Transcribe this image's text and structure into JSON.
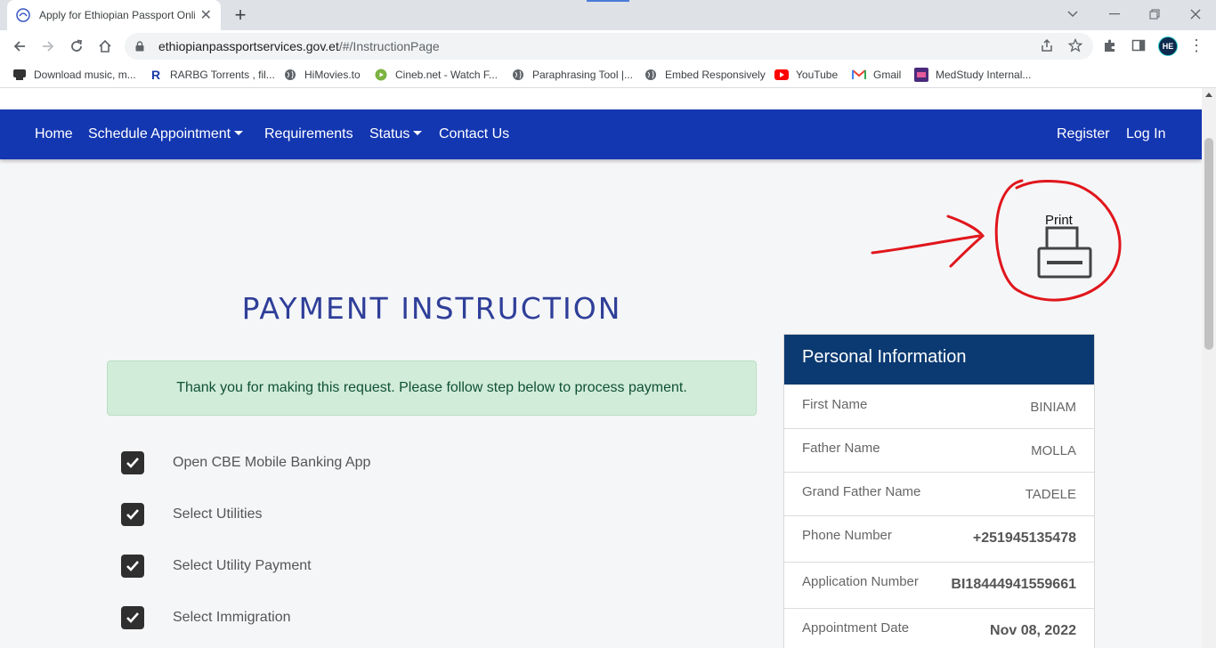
{
  "browser": {
    "tab_title": "Apply for Ethiopian Passport Onli",
    "url_host": "ethiopianpassportservices.gov.et",
    "url_path": "/#/InstructionPage",
    "new_tab": "+",
    "close_tab": "✕",
    "profile_initials": "HE",
    "bookmarks": [
      {
        "label": "Download music, m...",
        "icon": "download-icon"
      },
      {
        "label": "RARBG Torrents , fil...",
        "icon": "rarbg-icon"
      },
      {
        "label": "HiMovies.to",
        "icon": "globe-icon"
      },
      {
        "label": "Cineb.net - Watch F...",
        "icon": "cineb-icon"
      },
      {
        "label": "Paraphrasing Tool |...",
        "icon": "globe-icon"
      },
      {
        "label": "Embed Responsively",
        "icon": "globe-icon"
      },
      {
        "label": "YouTube",
        "icon": "youtube-icon"
      },
      {
        "label": "Gmail",
        "icon": "gmail-icon"
      },
      {
        "label": "MedStudy Internal...",
        "icon": "medstudy-icon"
      }
    ]
  },
  "nav": {
    "home": "Home",
    "schedule": "Schedule Appointment",
    "requirements": "Requirements",
    "status": "Status",
    "contact": "Contact Us",
    "register": "Register",
    "login": "Log In"
  },
  "print_label": "Print",
  "heading": "PAYMENT INSTRUCTION",
  "alert": "Thank you for making this request. Please follow step below to process payment.",
  "steps": [
    "Open CBE Mobile Banking App",
    "Select Utilities",
    "Select Utility Payment",
    "Select Immigration"
  ],
  "personal_info": {
    "title": "Personal Information",
    "rows": [
      {
        "label": "First Name",
        "value": "BINIAM"
      },
      {
        "label": "Father Name",
        "value": "MOLLA"
      },
      {
        "label": "Grand Father Name",
        "value": "TADELE"
      },
      {
        "label": "Phone Number",
        "value": "+251945135478"
      },
      {
        "label": "Application Number",
        "value": "BI18444941559661"
      },
      {
        "label": "Appointment Date",
        "value": "Nov 08, 2022"
      }
    ]
  },
  "colors": {
    "navbar": "#1336b1",
    "card_header": "#0b3a72",
    "heading": "#2f3f99",
    "alert_bg": "#d2ecda",
    "annotation": "#e0161c"
  }
}
